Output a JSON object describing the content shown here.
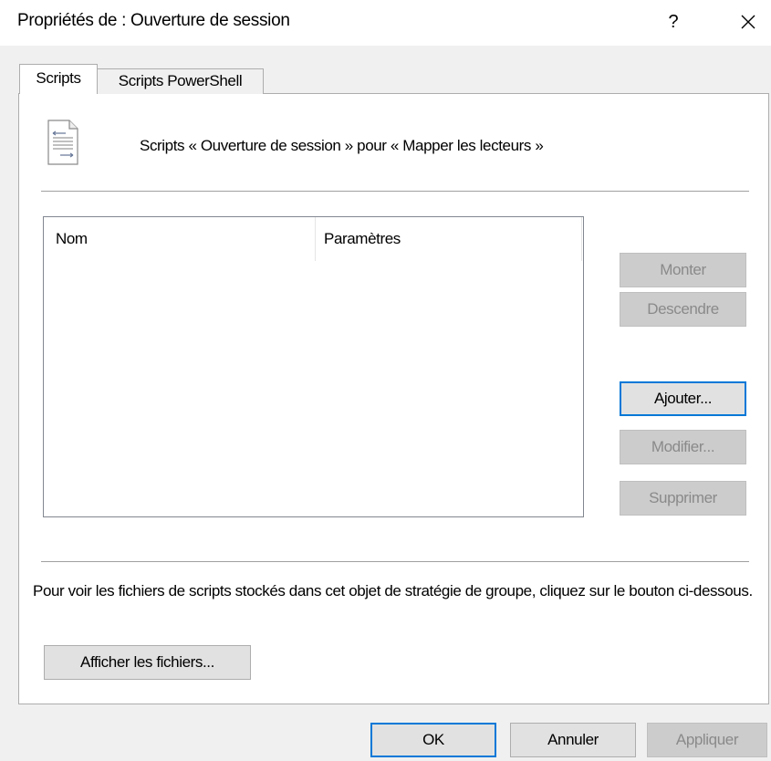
{
  "window": {
    "title": "Propriétés de : Ouverture de session",
    "help_label": "?"
  },
  "tabs": [
    {
      "label": "Scripts",
      "active": true
    },
    {
      "label": "Scripts PowerShell",
      "active": false
    }
  ],
  "header": {
    "text": "Scripts « Ouverture de session » pour « Mapper les lecteurs »",
    "icon": "script-document-icon"
  },
  "list": {
    "columns": [
      "Nom",
      "Paramètres"
    ],
    "rows": []
  },
  "side_buttons": {
    "monter": "Monter",
    "descendre": "Descendre",
    "ajouter": "Ajouter...",
    "modifier": "Modifier...",
    "supprimer": "Supprimer"
  },
  "info": {
    "text": "Pour voir les fichiers de scripts stockés dans cet objet de stratégie de groupe, cliquez sur le bouton ci-dessous.",
    "button": "Afficher les fichiers..."
  },
  "footer": {
    "ok": "OK",
    "annuler": "Annuler",
    "appliquer": "Appliquer"
  },
  "colors": {
    "focus": "#0078d7",
    "disabled_text": "#8a8a8a",
    "border": "#adadad"
  }
}
